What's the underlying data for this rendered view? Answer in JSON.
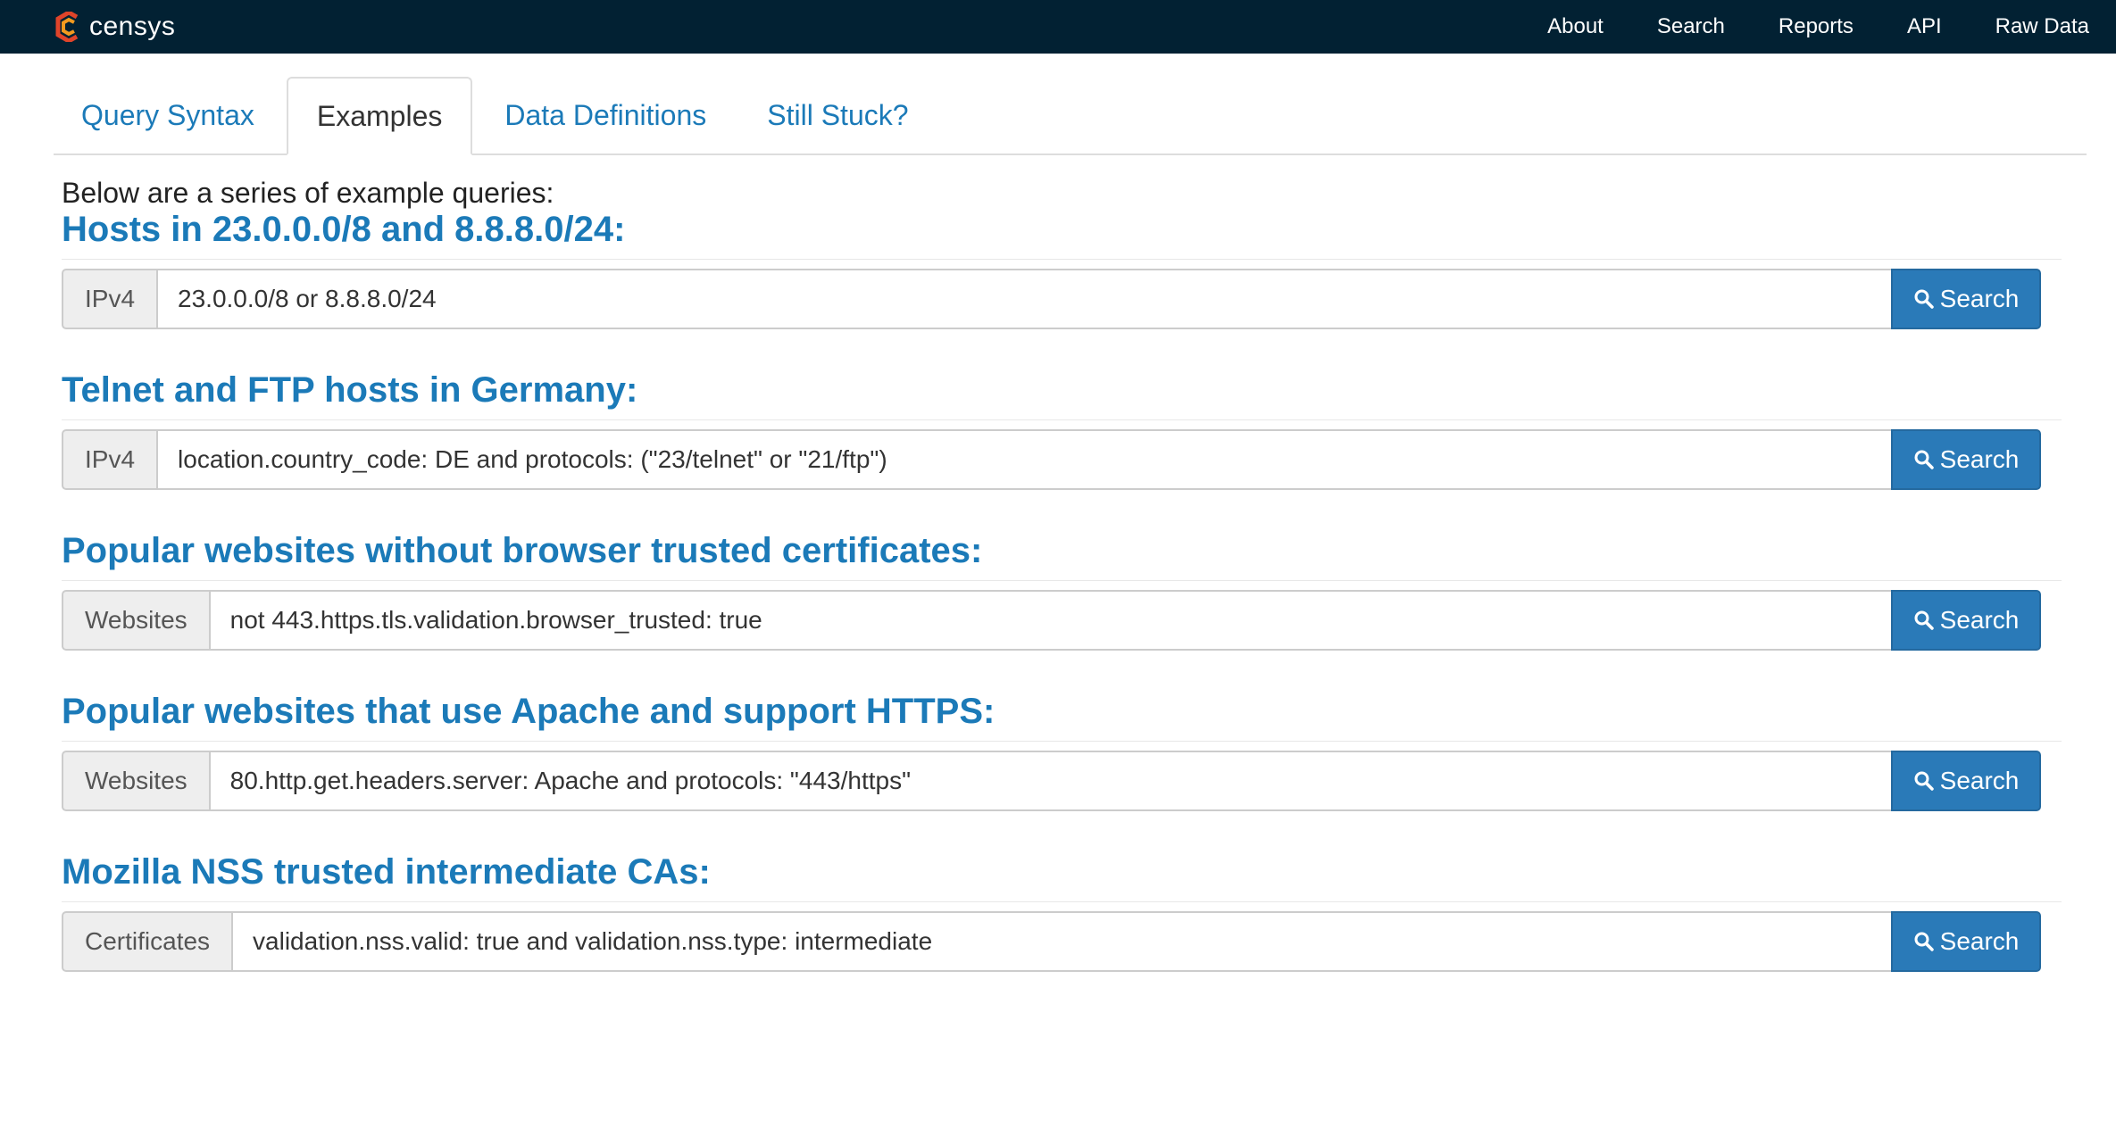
{
  "header": {
    "brand": "censys",
    "nav": [
      "About",
      "Search",
      "Reports",
      "API",
      "Raw Data"
    ]
  },
  "tabs": [
    {
      "label": "Query Syntax",
      "active": false
    },
    {
      "label": "Examples",
      "active": true
    },
    {
      "label": "Data Definitions",
      "active": false
    },
    {
      "label": "Still Stuck?",
      "active": false
    }
  ],
  "intro": "Below are a series of example queries:",
  "search_label": "Search",
  "examples": [
    {
      "title": "Hosts in 23.0.0.0/8 and 8.8.8.0/24:",
      "index": "IPv4",
      "query": "23.0.0.0/8 or 8.8.8.0/24"
    },
    {
      "title": "Telnet and FTP hosts in Germany:",
      "index": "IPv4",
      "query": "location.country_code: DE and protocols: (\"23/telnet\" or \"21/ftp\")"
    },
    {
      "title": "Popular websites without browser trusted certificates:",
      "index": "Websites",
      "query": "not 443.https.tls.validation.browser_trusted: true"
    },
    {
      "title": "Popular websites that use Apache and support HTTPS:",
      "index": "Websites",
      "query": "80.http.get.headers.server: Apache and protocols: \"443/https\""
    },
    {
      "title": "Mozilla NSS trusted intermediate CAs:",
      "index": "Certificates",
      "query": "validation.nss.valid: true and validation.nss.type: intermediate"
    }
  ],
  "colors": {
    "topbar": "#022133",
    "link": "#1b7ab8",
    "button": "#2a7ab8",
    "logo_red": "#e0442a",
    "logo_orange": "#f39a1f"
  },
  "icons": {
    "logo": "censys-logo-icon",
    "search": "search-icon"
  }
}
